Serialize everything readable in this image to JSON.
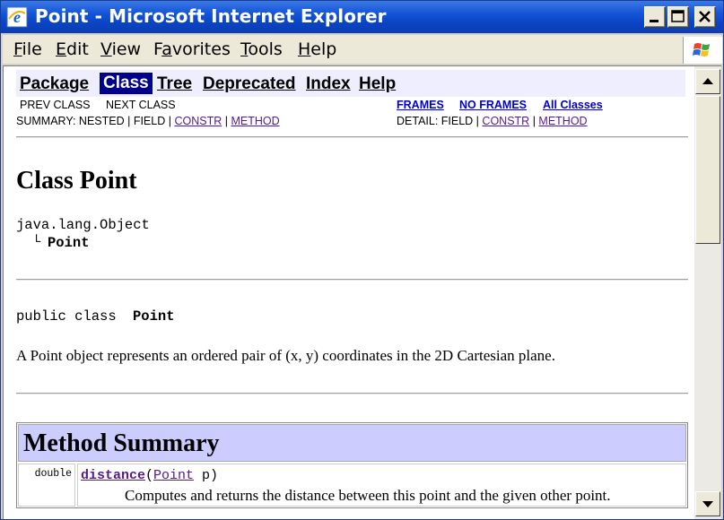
{
  "window": {
    "title": "Point - Microsoft Internet Explorer"
  },
  "menu": {
    "items": [
      {
        "pre": "",
        "key": "F",
        "post": "ile"
      },
      {
        "pre": "",
        "key": "E",
        "post": "dit"
      },
      {
        "pre": "",
        "key": "V",
        "post": "iew"
      },
      {
        "pre": "F",
        "key": "a",
        "post": "vorites"
      },
      {
        "pre": "",
        "key": "T",
        "post": "ools"
      },
      {
        "pre": "",
        "key": "H",
        "post": "elp"
      }
    ]
  },
  "nav": {
    "package": "Package",
    "class": "Class",
    "tree": "Tree",
    "deprecated": "Deprecated",
    "index": "Index",
    "help": "Help",
    "prev_class": "PREV CLASS",
    "next_class": "NEXT CLASS",
    "frames": "FRAMES",
    "no_frames": "NO FRAMES",
    "all_classes": "All Classes",
    "summary_label": "SUMMARY: NESTED | FIELD |",
    "summary_constr": "CONSTR",
    "summary_method": "METHOD",
    "detail_label": "DETAIL: FIELD |",
    "detail_constr": "CONSTR",
    "detail_method": "METHOD",
    "sep": "|"
  },
  "page": {
    "class_title": "Class Point",
    "hierarchy_root": "java.lang.Object",
    "hierarchy_branch": "└",
    "hierarchy_child": "Point",
    "declaration_prefix": "public class",
    "declaration_name": "Point",
    "description": "A Point object represents an ordered pair of (x, y) coordinates in the 2D Cartesian plane."
  },
  "method_summary": {
    "title": "Method Summary",
    "rows": [
      {
        "return_type": "double",
        "name": "distance",
        "open_paren": "(",
        "param_type": "Point",
        "param_rest": " p)",
        "description": "Computes and returns the distance between this point and the given other point."
      }
    ]
  },
  "colors": {
    "titlebar": "#0a43c4",
    "navbar_bg": "#eeeeff",
    "nav_selected": "#00008b",
    "table_header": "#ccccff",
    "visited_link": "#551a8b"
  }
}
